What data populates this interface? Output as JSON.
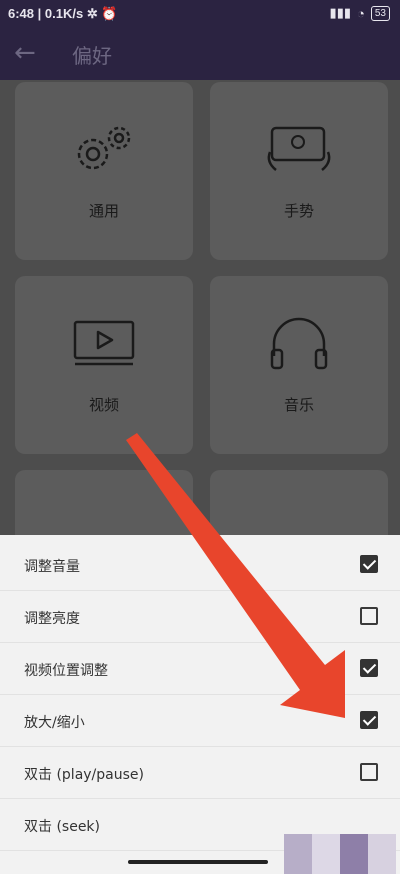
{
  "status_bar": {
    "time": "6:48",
    "speed": "0.1K/s",
    "battery": "53"
  },
  "header": {
    "title": "偏好"
  },
  "tiles": [
    {
      "label": "通用",
      "icon": "gears-icon"
    },
    {
      "label": "手势",
      "icon": "gesture-icon"
    },
    {
      "label": "视频",
      "icon": "video-icon"
    },
    {
      "label": "音乐",
      "icon": "headphones-icon"
    }
  ],
  "sheet": {
    "options": [
      {
        "label": "调整音量",
        "checked": true
      },
      {
        "label": "调整亮度",
        "checked": false
      },
      {
        "label": "视频位置调整",
        "checked": true
      },
      {
        "label": "放大/缩小",
        "checked": true
      },
      {
        "label": "双击 (play/pause)",
        "checked": false
      },
      {
        "label": "双击 (seek)",
        "checked": null
      }
    ]
  },
  "colors": {
    "app_bar": "#2b2341",
    "annotation_arrow": "#e8452c",
    "sheet_bg": "#f2f2f2"
  }
}
